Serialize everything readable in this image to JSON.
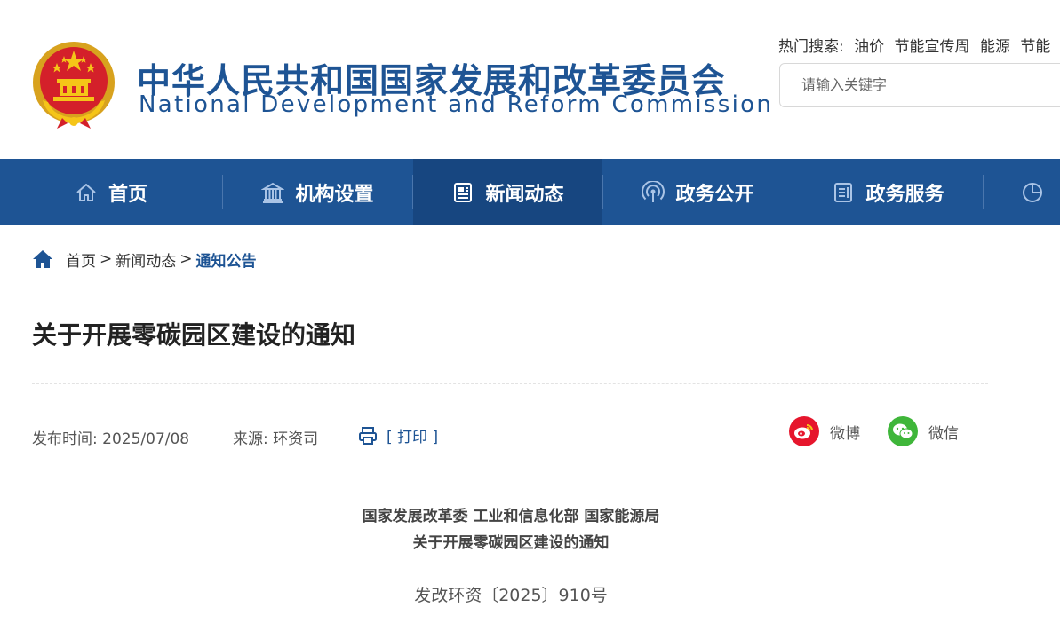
{
  "header": {
    "site_name_cn": "中华人民共和国国家发展和改革委员会",
    "site_name_en": "National Development and Reform Commission",
    "hot_search": {
      "label": "热门搜索:",
      "keywords": [
        "油价",
        "节能宣传周",
        "能源",
        "节能"
      ]
    },
    "search": {
      "placeholder": "请输入关键字",
      "value": ""
    }
  },
  "nav": {
    "items": [
      {
        "label": "首页",
        "icon": "home-icon"
      },
      {
        "label": "机构设置",
        "icon": "institution-icon"
      },
      {
        "label": "新闻动态",
        "icon": "news-icon",
        "active": true
      },
      {
        "label": "政务公开",
        "icon": "broadcast-icon"
      },
      {
        "label": "政务服务",
        "icon": "document-icon"
      },
      {
        "label": "",
        "icon": "pie-chart-icon"
      }
    ],
    "colors": {
      "background": "#1e5494",
      "active": "#174680"
    }
  },
  "breadcrumb": {
    "items": [
      "首页",
      "新闻动态"
    ],
    "separator": ">",
    "current": "通知公告"
  },
  "article": {
    "title": "关于开展零碳园区建设的通知",
    "date_label": "发布时间:",
    "date": "2025/07/08",
    "source_label": "来源:",
    "source": "环资司",
    "print_label": "[ 打印 ]",
    "share": {
      "weibo": "微博",
      "wechat": "微信"
    },
    "issuers": "国家发展改革委 工业和信息化部 国家能源局",
    "doc_title": "关于开展零碳园区建设的通知",
    "doc_number": "发改环资〔2025〕910号"
  }
}
